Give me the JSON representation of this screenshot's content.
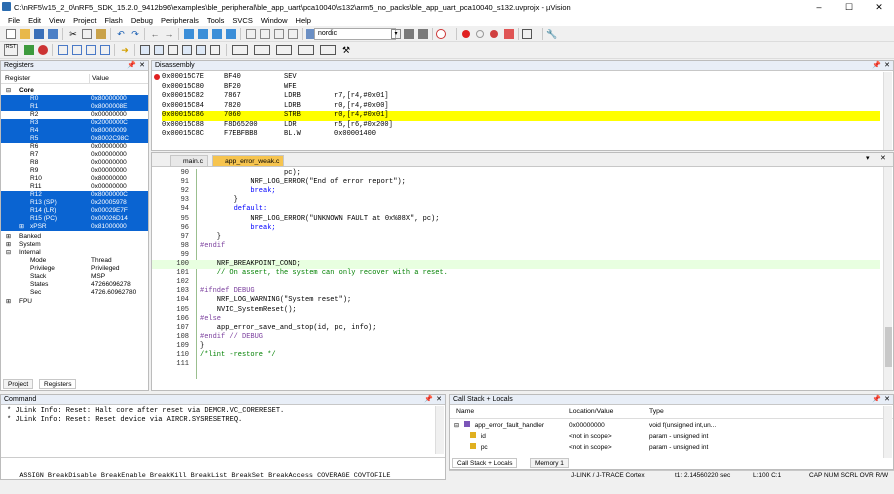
{
  "window": {
    "title": "C:\\nRF5\\v15_2_0\\nRF5_SDK_15.2.0_9412b96\\examples\\ble_peripheral\\ble_app_uart\\pca10040\\s132\\arm5_no_packs\\ble_app_uart_pca10040_s132.uvprojx - µVision",
    "minimize": "–",
    "maximize": "☐",
    "close": "✕"
  },
  "menu": [
    "File",
    "Edit",
    "View",
    "Project",
    "Flash",
    "Debug",
    "Peripherals",
    "Tools",
    "SVCS",
    "Window",
    "Help"
  ],
  "toolbar": {
    "target": "nordic"
  },
  "registers": {
    "title": "Registers",
    "col_register": "Register",
    "col_value": "Value",
    "core_label": "Core",
    "rows": [
      {
        "name": "R0",
        "value": "0x80000000",
        "sel": true
      },
      {
        "name": "R1",
        "value": "0x8000008E",
        "sel": true
      },
      {
        "name": "R2",
        "value": "0x00000000",
        "sel": false
      },
      {
        "name": "R3",
        "value": "0x2000000C",
        "sel": true
      },
      {
        "name": "R4",
        "value": "0x80000009",
        "sel": true
      },
      {
        "name": "R5",
        "value": "0x8002C98C",
        "sel": true
      },
      {
        "name": "R6",
        "value": "0x00000000",
        "sel": false
      },
      {
        "name": "R7",
        "value": "0x00000000",
        "sel": false
      },
      {
        "name": "R8",
        "value": "0x00000000",
        "sel": false
      },
      {
        "name": "R9",
        "value": "0x00000000",
        "sel": false
      },
      {
        "name": "R10",
        "value": "0x80000000",
        "sel": false
      },
      {
        "name": "R11",
        "value": "0x00000000",
        "sel": false
      },
      {
        "name": "R12",
        "value": "0x8000000C",
        "sel": true
      },
      {
        "name": "R13 (SP)",
        "value": "0x20005978",
        "sel": true
      },
      {
        "name": "R14 (LR)",
        "value": "0x00029E7F",
        "sel": true
      },
      {
        "name": "R15 (PC)",
        "value": "0x00026D14",
        "sel": true
      },
      {
        "name": "xPSR",
        "value": "0x81000000",
        "sel": true
      }
    ],
    "groups": [
      "Banked",
      "System",
      "Internal"
    ],
    "internal_rows": [
      {
        "name": "Mode",
        "value": "Thread"
      },
      {
        "name": "Privilege",
        "value": "Privileged"
      },
      {
        "name": "Stack",
        "value": "MSP"
      },
      {
        "name": "States",
        "value": "47266096278"
      },
      {
        "name": "Sec",
        "value": "4726.60962780"
      }
    ],
    "fpu_label": "FPU",
    "tabs": [
      "Project",
      "Registers"
    ]
  },
  "disassembly": {
    "title": "Disassembly",
    "lines": [
      {
        "addr": "0x00015C7E",
        "code": "BF40",
        "mn": "SEV",
        "ops": "",
        "hl": false
      },
      {
        "addr": "0x00015C80",
        "code": "BF20",
        "mn": "WFE",
        "ops": "",
        "hl": false
      },
      {
        "addr": "0x00015C82",
        "code": "7867",
        "mn": "LDRB",
        "ops": "r7,[r4,#0x01]",
        "hl": false
      },
      {
        "addr": "0x00015C84",
        "code": "7820",
        "mn": "LDRB",
        "ops": "r0,[r4,#0x00]",
        "hl": false
      },
      {
        "addr": "0x00015C86",
        "code": "7060",
        "mn": "STRB",
        "ops": "r0,[r4,#0x01]",
        "hl": true
      },
      {
        "addr": "0x00015C88",
        "code": "F8D65200",
        "mn": "LDR",
        "ops": "r5,[r6,#0x200]",
        "hl": false
      },
      {
        "addr": "0x00015C8C",
        "code": "F7EBFBB8",
        "mn": "BL.W",
        "ops": "0x00001400",
        "hl": false
      }
    ]
  },
  "editor": {
    "tabs": [
      "main.c",
      "app_error_weak.c"
    ],
    "lines": [
      {
        "n": "90",
        "t": "                    pc);"
      },
      {
        "n": "91",
        "t": "            NRF_LOG_ERROR(\"End of error report\");"
      },
      {
        "n": "92",
        "t": "            break;"
      },
      {
        "n": "93",
        "t": "        }"
      },
      {
        "n": "94",
        "t": "        default:"
      },
      {
        "n": "95",
        "t": "            NRF_LOG_ERROR(\"UNKNOWN FAULT at 0x%08X\", pc);"
      },
      {
        "n": "96",
        "t": "            break;"
      },
      {
        "n": "97",
        "t": "    }"
      },
      {
        "n": "98",
        "t": "#endif"
      },
      {
        "n": "99",
        "t": ""
      },
      {
        "n": "100",
        "t": "    NRF_BREAKPOINT_COND;"
      },
      {
        "n": "101",
        "t": "    // On assert, the system can only recover with a reset."
      },
      {
        "n": "102",
        "t": ""
      },
      {
        "n": "103",
        "t": "#ifndef DEBUG"
      },
      {
        "n": "104",
        "t": "    NRF_LOG_WARNING(\"System reset\");"
      },
      {
        "n": "105",
        "t": "    NVIC_SystemReset();"
      },
      {
        "n": "106",
        "t": "#else"
      },
      {
        "n": "107",
        "t": "    app_error_save_and_stop(id, pc, info);"
      },
      {
        "n": "108",
        "t": "#endif // DEBUG"
      },
      {
        "n": "109",
        "t": "}"
      },
      {
        "n": "110",
        "t": "/*lint -restore */"
      },
      {
        "n": "111",
        "t": ""
      }
    ]
  },
  "command": {
    "title": "Command",
    "lines": [
      "* JLink Info: Reset: Halt core after reset via DEMCR.VC_CORERESET.",
      "* JLink Info: Reset: Reset device via AIRCR.SYSRESETREQ."
    ],
    "prompt": "ASSIGN BreakDisable BreakEnable BreakKill BreakList BreakSet BreakAccess COVERAGE COVTOFILE"
  },
  "callstack": {
    "title": "Call Stack + Locals",
    "col_name": "Name",
    "col_loc": "Location/Value",
    "col_type": "Type",
    "rows": [
      {
        "name": "app_error_fault_handler",
        "loc": "0x00000000",
        "type": "void f(unsigned int,un..."
      },
      {
        "name": "id",
        "loc": "<not in scope>",
        "type": "param - unsigned int"
      },
      {
        "name": "pc",
        "loc": "<not in scope>",
        "type": "param - unsigned int"
      }
    ],
    "tabs": [
      "Call Stack + Locals",
      "Memory 1"
    ]
  },
  "status": {
    "debugger": "J-LINK / J-TRACE Cortex",
    "time": "t1: 2.14560220 sec",
    "pos": "L:100 C:1",
    "keys": "CAP  NUM  SCRL  OVR  R/W"
  }
}
